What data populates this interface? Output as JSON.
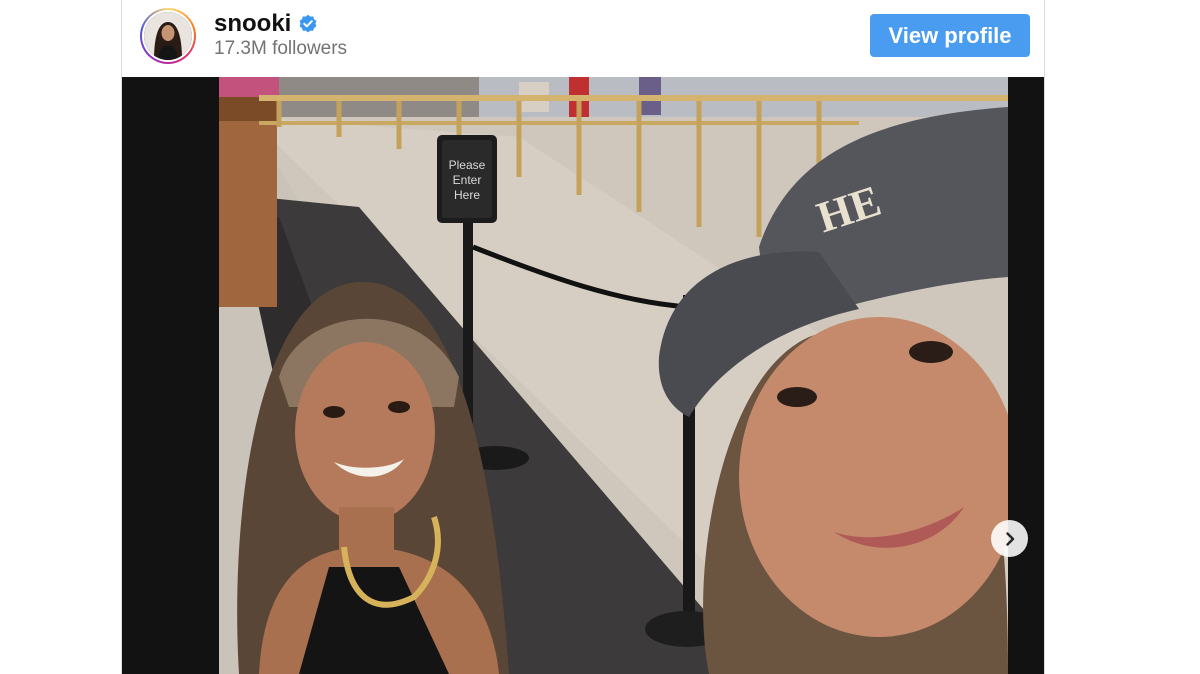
{
  "profile": {
    "username": "snooki",
    "verified": true,
    "followers": "17.3M followers",
    "avatar_icon": "profile-photo"
  },
  "actions": {
    "view_profile_label": "View profile"
  },
  "post": {
    "media_type": "photo",
    "sign_text": [
      "Please",
      "Enter",
      "Here"
    ],
    "next_icon": "chevron-right-icon"
  },
  "colors": {
    "button": "#4a9cf0",
    "verified": "#3897f0",
    "followers_text": "#737373"
  }
}
